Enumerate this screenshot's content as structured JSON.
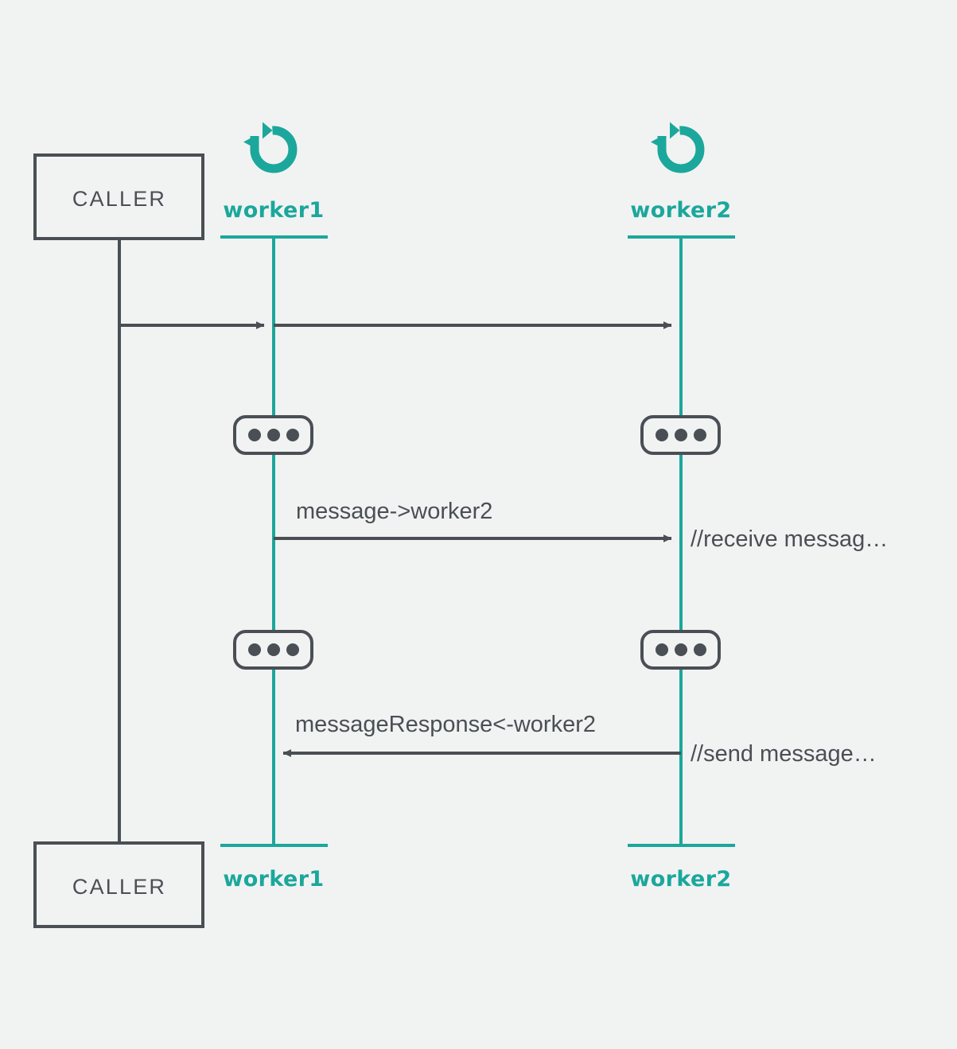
{
  "diagram": {
    "type": "sequence-diagram",
    "background_color": "#f1f3f2",
    "colors": {
      "accent_teal": "#1ba79c",
      "line_dark": "#4a4f55",
      "text_dark": "#4a4f55",
      "box_fill": "#f1f3f2"
    },
    "actors": {
      "caller_top": {
        "label": "CALLER",
        "shape": "rectangle"
      },
      "caller_bottom": {
        "label": "CALLER",
        "shape": "rectangle"
      }
    },
    "participants": [
      {
        "id": "worker1",
        "top_label": "worker1",
        "bottom_label": "worker1",
        "icon": "rotate-ccw-icon"
      },
      {
        "id": "worker2",
        "top_label": "worker2",
        "bottom_label": "worker2",
        "icon": "rotate-ccw-icon"
      }
    ],
    "messages": [
      {
        "index": 1,
        "from": "caller",
        "to": "worker1",
        "label": "",
        "direction": "right",
        "style": "solid"
      },
      {
        "index": 2,
        "from": "caller",
        "to": "worker2",
        "label": "",
        "direction": "right",
        "style": "solid"
      },
      {
        "index": 3,
        "from": "worker1",
        "to": "worker2",
        "label": "message->worker2",
        "direction": "right",
        "style": "solid"
      },
      {
        "index": 4,
        "from": "worker2",
        "to": "worker1",
        "label": "messageResponse<-worker2",
        "direction": "left",
        "style": "solid"
      }
    ],
    "notes": [
      {
        "id": "note-receive",
        "text": "//receive messag…",
        "attached_to": "worker2"
      },
      {
        "id": "note-send",
        "text": "//send message…",
        "attached_to": "worker2"
      }
    ],
    "activations": [
      {
        "id": "activation-w1-1",
        "participant": "worker1",
        "glyph": "•••"
      },
      {
        "id": "activation-w2-1",
        "participant": "worker2",
        "glyph": "•••"
      },
      {
        "id": "activation-w1-2",
        "participant": "worker1",
        "glyph": "•••"
      },
      {
        "id": "activation-w2-2",
        "participant": "worker2",
        "glyph": "•••"
      }
    ]
  }
}
